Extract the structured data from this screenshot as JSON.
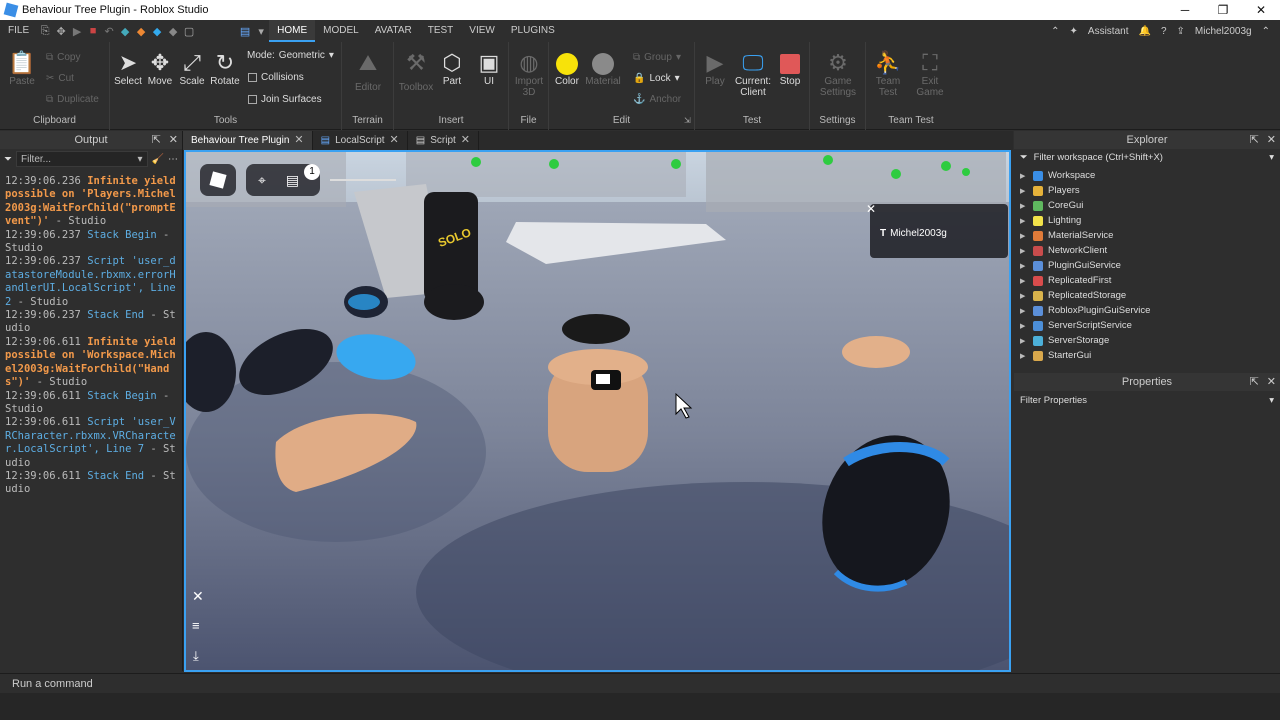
{
  "window": {
    "title": "Behaviour Tree Plugin - Roblox Studio",
    "minimize": "─",
    "maximize": "❐",
    "close": "✕"
  },
  "menubar": {
    "file": "FILE",
    "tabs": [
      "HOME",
      "MODEL",
      "AVATAR",
      "TEST",
      "VIEW",
      "PLUGINS"
    ],
    "assistant": "Assistant",
    "user": "Michel2003g"
  },
  "ribbon": {
    "clipboard": {
      "label": "Clipboard",
      "paste": "Paste",
      "copy": "Copy",
      "cut": "Cut",
      "duplicate": "Duplicate"
    },
    "tools": {
      "label": "Tools",
      "select": "Select",
      "move": "Move",
      "scale": "Scale",
      "rotate": "Rotate",
      "mode_label": "Mode:",
      "mode_value": "Geometric",
      "collisions": "Collisions",
      "join_surfaces": "Join Surfaces"
    },
    "terrain": {
      "label": "Terrain",
      "editor": "Editor"
    },
    "insert": {
      "label": "Insert",
      "toolbox": "Toolbox",
      "part": "Part",
      "ui": "UI"
    },
    "file": {
      "label": "File",
      "import3d": "Import 3D"
    },
    "edit": {
      "label": "Edit",
      "color": "Color",
      "material": "Material",
      "group": "Group",
      "lock": "Lock",
      "anchor": "Anchor"
    },
    "test": {
      "label": "Test",
      "play": "Play",
      "current_client": "Current: Client",
      "stop": "Stop"
    },
    "settings": {
      "label": "Settings",
      "game_settings": "Game Settings"
    },
    "team_test": {
      "label": "Team Test",
      "team_test": "Team Test",
      "exit_game": "Exit Game"
    }
  },
  "output": {
    "title": "Output",
    "filter_placeholder": "Filter...",
    "logs": [
      {
        "text": "12:39:06.236  ",
        "cls": ""
      },
      {
        "text": "Infinite yield possible on 'Players.Michel2003g:WaitForChild(\"promptEvent\")'",
        "cls": "warn"
      },
      {
        "text": "  -  Studio",
        "cls": ""
      },
      {
        "text": "12:39:06.237  ",
        "cls": ""
      },
      {
        "text": "Stack Begin",
        "cls": "info"
      },
      {
        "text": "  -  Studio",
        "cls": ""
      },
      {
        "text": "12:39:06.237  ",
        "cls": ""
      },
      {
        "text": "Script 'user_datastoreModule.rbxmx.errorHandlerUI.LocalScript', Line 2",
        "cls": "info"
      },
      {
        "text": "  -  Studio",
        "cls": ""
      },
      {
        "text": "12:39:06.237  ",
        "cls": ""
      },
      {
        "text": "Stack End",
        "cls": "info"
      },
      {
        "text": "  -  Studio",
        "cls": ""
      },
      {
        "text": "12:39:06.611  ",
        "cls": ""
      },
      {
        "text": "Infinite yield possible on 'Workspace.Michel2003g:WaitForChild(\"Hands\")'",
        "cls": "warn"
      },
      {
        "text": "  -  Studio",
        "cls": ""
      },
      {
        "text": "12:39:06.611  ",
        "cls": ""
      },
      {
        "text": "Stack Begin",
        "cls": "info"
      },
      {
        "text": "  -  Studio",
        "cls": ""
      },
      {
        "text": "12:39:06.611  ",
        "cls": ""
      },
      {
        "text": "Script 'user_VRCharacter.rbxmx.VRCharacter.LocalScript', Line 7",
        "cls": "info"
      },
      {
        "text": "  -  Studio",
        "cls": ""
      },
      {
        "text": "12:39:06.611  ",
        "cls": ""
      },
      {
        "text": "Stack End",
        "cls": "info"
      },
      {
        "text": "  -  Studio",
        "cls": ""
      }
    ]
  },
  "tabs": [
    {
      "label": "Behaviour Tree Plugin",
      "active": true
    },
    {
      "label": "LocalScript",
      "active": false
    },
    {
      "label": "Script",
      "active": false
    }
  ],
  "viewport": {
    "player_name": "Michel2003g",
    "badge": "1",
    "shirt_text": "SOLO"
  },
  "explorer": {
    "title": "Explorer",
    "filter_placeholder": "Filter workspace (Ctrl+Shift+X)",
    "items": [
      {
        "name": "Workspace",
        "color": "#3a8ee6"
      },
      {
        "name": "Players",
        "color": "#e6b23a"
      },
      {
        "name": "CoreGui",
        "color": "#5fb85f"
      },
      {
        "name": "Lighting",
        "color": "#f2e24a"
      },
      {
        "name": "MaterialService",
        "color": "#e07b39"
      },
      {
        "name": "NetworkClient",
        "color": "#c94c4c"
      },
      {
        "name": "PluginGuiService",
        "color": "#5b8fd9"
      },
      {
        "name": "ReplicatedFirst",
        "color": "#d94c4c"
      },
      {
        "name": "ReplicatedStorage",
        "color": "#d9b34c"
      },
      {
        "name": "RobloxPluginGuiService",
        "color": "#5b8fd9"
      },
      {
        "name": "ServerScriptService",
        "color": "#4c8fd9"
      },
      {
        "name": "ServerStorage",
        "color": "#4cb0d9"
      },
      {
        "name": "StarterGui",
        "color": "#d9a84c"
      }
    ]
  },
  "properties": {
    "title": "Properties",
    "filter_placeholder": "Filter Properties"
  },
  "command": {
    "placeholder": "Run a command"
  }
}
